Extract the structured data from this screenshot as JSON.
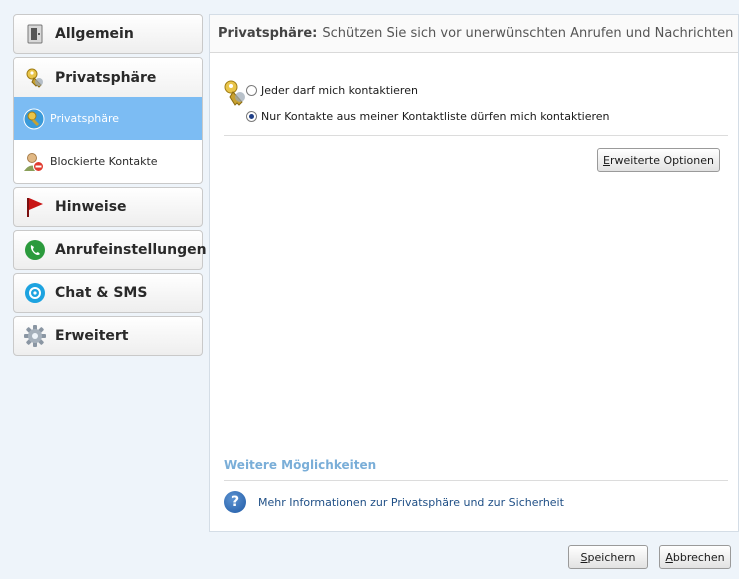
{
  "sidebar": {
    "general": {
      "label": "Allgemein",
      "icon": "door-icon"
    },
    "privacy": {
      "label": "Privatsphäre",
      "icon": "key-icon",
      "items": [
        {
          "label": "Privatsphäre",
          "icon": "key-shield-icon",
          "active": true
        },
        {
          "label": "Blockierte Kontakte",
          "icon": "blocked-user-icon",
          "active": false
        }
      ]
    },
    "notifications": {
      "label": "Hinweise",
      "icon": "flag-icon"
    },
    "calls": {
      "label": "Anrufeinstellungen",
      "icon": "phone-icon"
    },
    "chat": {
      "label": "Chat & SMS",
      "icon": "chat-icon"
    },
    "advanced": {
      "label": "Erweitert",
      "icon": "gear-icon"
    }
  },
  "main": {
    "header": {
      "title": "Privatsphäre:",
      "subtitle": "Schützen Sie sich vor unerwünschten Anrufen und Nachrichten"
    },
    "options": [
      {
        "label": "Jeder darf mich kontaktieren",
        "checked": false
      },
      {
        "label": "Nur Kontakte aus meiner Kontaktliste dürfen mich kontaktieren",
        "checked": true
      }
    ],
    "advanced_button": {
      "access_key": "E",
      "label_rest": "rweiterte Optionen"
    },
    "more": {
      "title": "Weitere Möglichkeiten",
      "link": "Mehr Informationen zur Privatsphäre und zur Sicherheit"
    }
  },
  "footer": {
    "save": {
      "access_key": "S",
      "label_rest": "peichern"
    },
    "cancel": {
      "access_key": "A",
      "label_rest": "bbrechen"
    }
  },
  "colors": {
    "active_item": "#7cbcf3",
    "link": "#1f4f86",
    "section_title": "#7aaed8"
  }
}
